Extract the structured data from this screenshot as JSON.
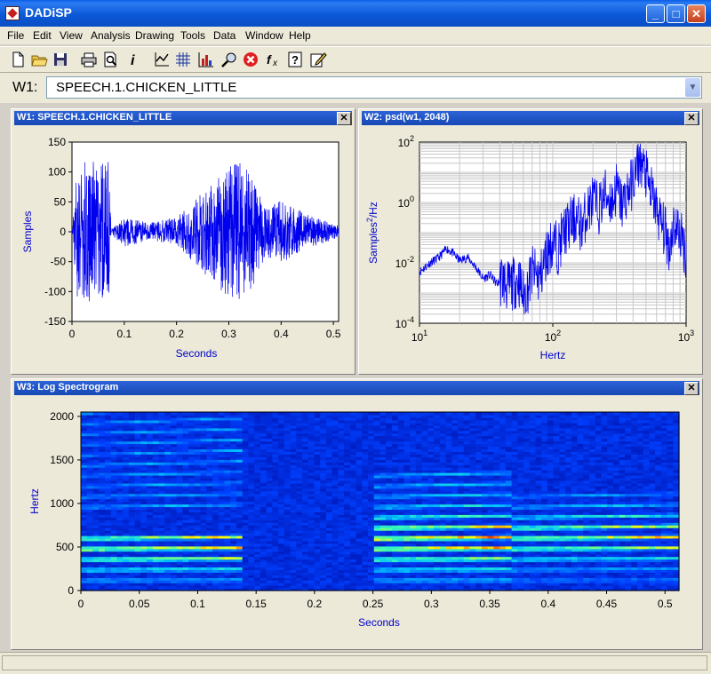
{
  "app": {
    "title": "DADiSP"
  },
  "window_buttons": {
    "minimize": "_",
    "maximize": "□",
    "close": "✕"
  },
  "menu": [
    "File",
    "Edit",
    "View",
    "Analysis",
    "Drawing",
    "Tools",
    "Data",
    "Window",
    "Help"
  ],
  "toolbar_icons": [
    "new-file-icon",
    "open-folder-icon",
    "save-icon",
    "print-icon",
    "print-preview-icon",
    "info-icon",
    "graph-icon",
    "grid-icon",
    "bar-chart-icon",
    "zoom-icon",
    "stop-icon",
    "function-icon",
    "help-icon",
    "edit-icon"
  ],
  "window_selector": {
    "label": "W1:",
    "value": "SPEECH.1.CHICKEN_LITTLE"
  },
  "panels": {
    "w1": {
      "title": "W1: SPEECH.1.CHICKEN_LITTLE",
      "close": "✕",
      "chart_data": {
        "type": "line",
        "xlabel": "Seconds",
        "ylabel": "Samples",
        "xlim": [
          0,
          0.51
        ],
        "ylim": [
          -150,
          150
        ],
        "xticks": [
          "0",
          "0.1",
          "0.2",
          "0.3",
          "0.4",
          "0.5"
        ],
        "yticks": [
          "150",
          "100",
          "50",
          "0",
          "-50",
          "-100",
          "-150"
        ],
        "envelope": {
          "x": [
            0,
            0.01,
            0.03,
            0.05,
            0.07,
            0.075,
            0.1,
            0.15,
            0.2,
            0.22,
            0.25,
            0.3,
            0.32,
            0.35,
            0.37,
            0.4,
            0.45,
            0.48,
            0.51
          ],
          "amplitude": [
            0,
            110,
            120,
            115,
            120,
            5,
            25,
            15,
            25,
            40,
            70,
            115,
            120,
            90,
            40,
            55,
            30,
            20,
            10
          ]
        },
        "color": "#0000ee"
      }
    },
    "w2": {
      "title": "W2: psd(w1, 2048)",
      "close": "✕",
      "chart_data": {
        "type": "line",
        "xscale": "log",
        "yscale": "log",
        "xlabel": "Hertz",
        "ylabel": "Samples²/Hz",
        "ylabel_base": "Samples",
        "ylabel_exp": "2",
        "ylabel_tail": "/Hz",
        "xlim": [
          10,
          1000
        ],
        "ylim": [
          0.0001,
          100
        ],
        "xticks": [
          {
            "base": "10",
            "exp": "1"
          },
          {
            "base": "10",
            "exp": "2"
          },
          {
            "base": "10",
            "exp": "3"
          }
        ],
        "yticks": [
          {
            "base": "10",
            "exp": "2"
          },
          {
            "base": "10",
            "exp": "0"
          },
          {
            "base": "10",
            "exp": "-2"
          },
          {
            "base": "10",
            "exp": "-4"
          }
        ],
        "x": [
          10,
          12,
          14,
          16,
          18,
          20,
          23,
          26,
          30,
          34,
          38,
          42,
          46,
          50,
          55,
          60,
          65,
          70,
          80,
          90,
          100,
          110,
          120,
          135,
          150,
          165,
          180,
          200,
          220,
          250,
          280,
          300,
          330,
          360,
          400,
          420,
          450,
          480,
          500,
          520,
          550,
          600,
          650,
          700,
          750,
          800,
          900,
          1000
        ],
        "y": [
          0.005,
          0.01,
          0.015,
          0.03,
          0.02,
          0.012,
          0.015,
          0.008,
          0.003,
          0.004,
          0.002,
          0.003,
          0.0015,
          0.002,
          0.003,
          0.0008,
          0.0015,
          0.005,
          0.003,
          0.02,
          0.05,
          0.03,
          0.1,
          0.2,
          0.3,
          0.15,
          0.5,
          1.2,
          0.6,
          2,
          1,
          3,
          0.8,
          2,
          5,
          10,
          30,
          12,
          8,
          4,
          2,
          0.6,
          0.2,
          0.1,
          0.03,
          0.2,
          0.1,
          0.02
        ],
        "color": "#0000ee"
      }
    },
    "w3": {
      "title": "W3: Log Spectrogram",
      "close": "✕",
      "chart_data": {
        "type": "heatmap",
        "xlabel": "Seconds",
        "ylabel": "Hertz",
        "xlim": [
          0,
          0.512
        ],
        "ylim": [
          0,
          2050
        ],
        "xticks": [
          "0",
          "0.05",
          "0.1",
          "0.15",
          "0.2",
          "0.25",
          "0.3",
          "0.35",
          "0.4",
          "0.45",
          "0.5"
        ],
        "yticks": [
          "2000",
          "1500",
          "1000",
          "500",
          "0"
        ],
        "colormap": [
          "#00008f",
          "#0040ff",
          "#00c0ff",
          "#40ffb0",
          "#ffff00",
          "#ff8000",
          "#e00000"
        ],
        "formant_segments": [
          {
            "x0": 0,
            "x1": 0.14,
            "f0": 120,
            "harmonics": [
              1,
              2,
              3,
              4,
              5,
              8,
              9,
              10,
              11,
              12,
              13,
              14,
              15,
              16,
              17
            ],
            "peak_hz": 500,
            "level": 0.85
          },
          {
            "x0": 0.25,
            "x1": 0.37,
            "f0": 120,
            "harmonics": [
              1,
              2,
              3,
              4,
              5,
              6,
              7,
              8,
              9,
              10,
              11
            ],
            "peak_hz": 560,
            "level": 1.0
          },
          {
            "x0": 0.37,
            "x1": 0.512,
            "f0": 120,
            "harmonics": [
              1,
              2,
              3,
              4,
              5,
              6,
              7,
              8,
              9
            ],
            "peak_hz": 600,
            "level": 0.8
          }
        ]
      }
    }
  }
}
